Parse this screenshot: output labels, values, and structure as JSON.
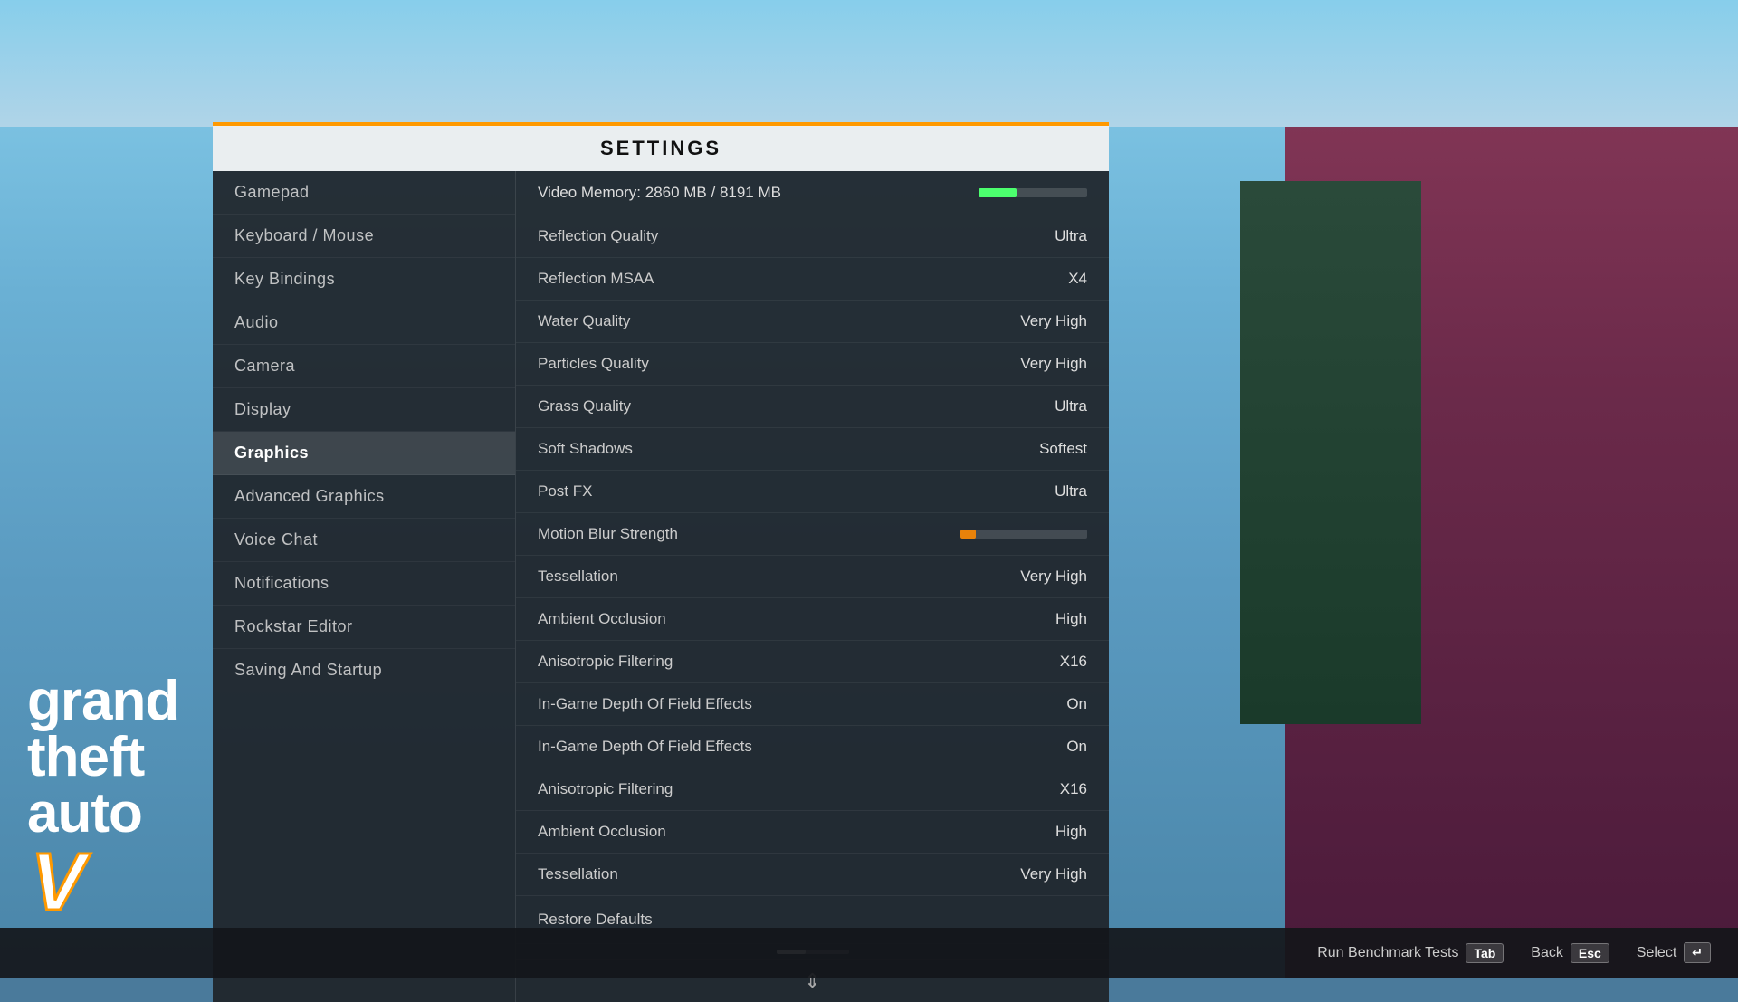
{
  "title": "SETTINGS",
  "nav": {
    "items": [
      {
        "id": "gamepad",
        "label": "Gamepad",
        "active": false
      },
      {
        "id": "keyboard-mouse",
        "label": "Keyboard / Mouse",
        "active": false
      },
      {
        "id": "key-bindings",
        "label": "Key Bindings",
        "active": false
      },
      {
        "id": "audio",
        "label": "Audio",
        "active": false
      },
      {
        "id": "camera",
        "label": "Camera",
        "active": false
      },
      {
        "id": "display",
        "label": "Display",
        "active": false
      },
      {
        "id": "graphics",
        "label": "Graphics",
        "active": true
      },
      {
        "id": "advanced-graphics",
        "label": "Advanced Graphics",
        "active": false
      },
      {
        "id": "voice-chat",
        "label": "Voice Chat",
        "active": false
      },
      {
        "id": "notifications",
        "label": "Notifications",
        "active": false
      },
      {
        "id": "rockstar-editor",
        "label": "Rockstar Editor",
        "active": false
      },
      {
        "id": "saving-startup",
        "label": "Saving And Startup",
        "active": false
      }
    ]
  },
  "content": {
    "memory": {
      "label": "Video Memory: 2860 MB / 8191 MB",
      "fill_percent": 35
    },
    "settings": [
      {
        "name": "Reflection Quality",
        "value": "Ultra"
      },
      {
        "name": "Reflection MSAA",
        "value": "X4"
      },
      {
        "name": "Water Quality",
        "value": "Very High"
      },
      {
        "name": "Particles Quality",
        "value": "Very High"
      },
      {
        "name": "Grass Quality",
        "value": "Ultra"
      },
      {
        "name": "Soft Shadows",
        "value": "Softest"
      },
      {
        "name": "Post FX",
        "value": "Ultra"
      },
      {
        "name": "In-Game Depth Of Field Effects",
        "value": "On"
      },
      {
        "name": "Anisotropic Filtering",
        "value": "X16"
      },
      {
        "name": "Ambient Occlusion",
        "value": "High"
      },
      {
        "name": "Tessellation",
        "value": "Very High"
      }
    ],
    "motion_blur": {
      "name": "Motion Blur Strength",
      "fill_percent": 12
    },
    "restore_defaults": "Restore Defaults"
  },
  "bottom_hints": [
    {
      "id": "benchmark",
      "label": "Run Benchmark Tests",
      "key": "Tab"
    },
    {
      "id": "back",
      "label": "Back",
      "key": "Esc"
    },
    {
      "id": "select",
      "label": "Select",
      "key": "↵"
    }
  ]
}
